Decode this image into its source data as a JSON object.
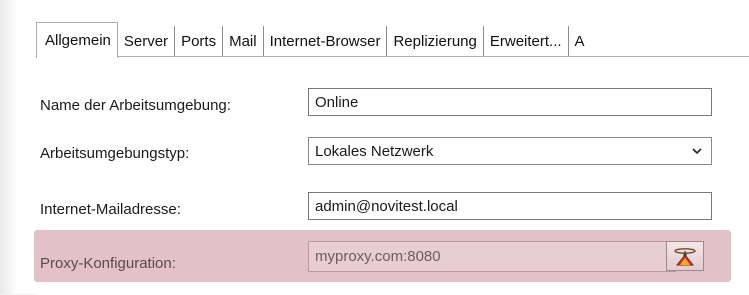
{
  "tabs": [
    {
      "label": "Allgemein",
      "active": true
    },
    {
      "label": "Server"
    },
    {
      "label": "Ports"
    },
    {
      "label": "Mail"
    },
    {
      "label": "Internet-Browser"
    },
    {
      "label": "Replizierung"
    },
    {
      "label": "Erweitert..."
    },
    {
      "label": "A"
    }
  ],
  "form": {
    "name": {
      "label": "Name der Arbeitsumgebung:",
      "value": "Online"
    },
    "type": {
      "label": "Arbeitsumgebungstyp:",
      "value": "Lokales Netzwerk"
    },
    "mail": {
      "label": "Internet-Mailadresse:",
      "value": "admin@novitest.local"
    },
    "proxy": {
      "label": "Proxy-Konfiguration:",
      "value": "myproxy.com:8080",
      "highlight_color": "#e3c1c8",
      "button_icon": "proxy-settings-icon"
    }
  }
}
